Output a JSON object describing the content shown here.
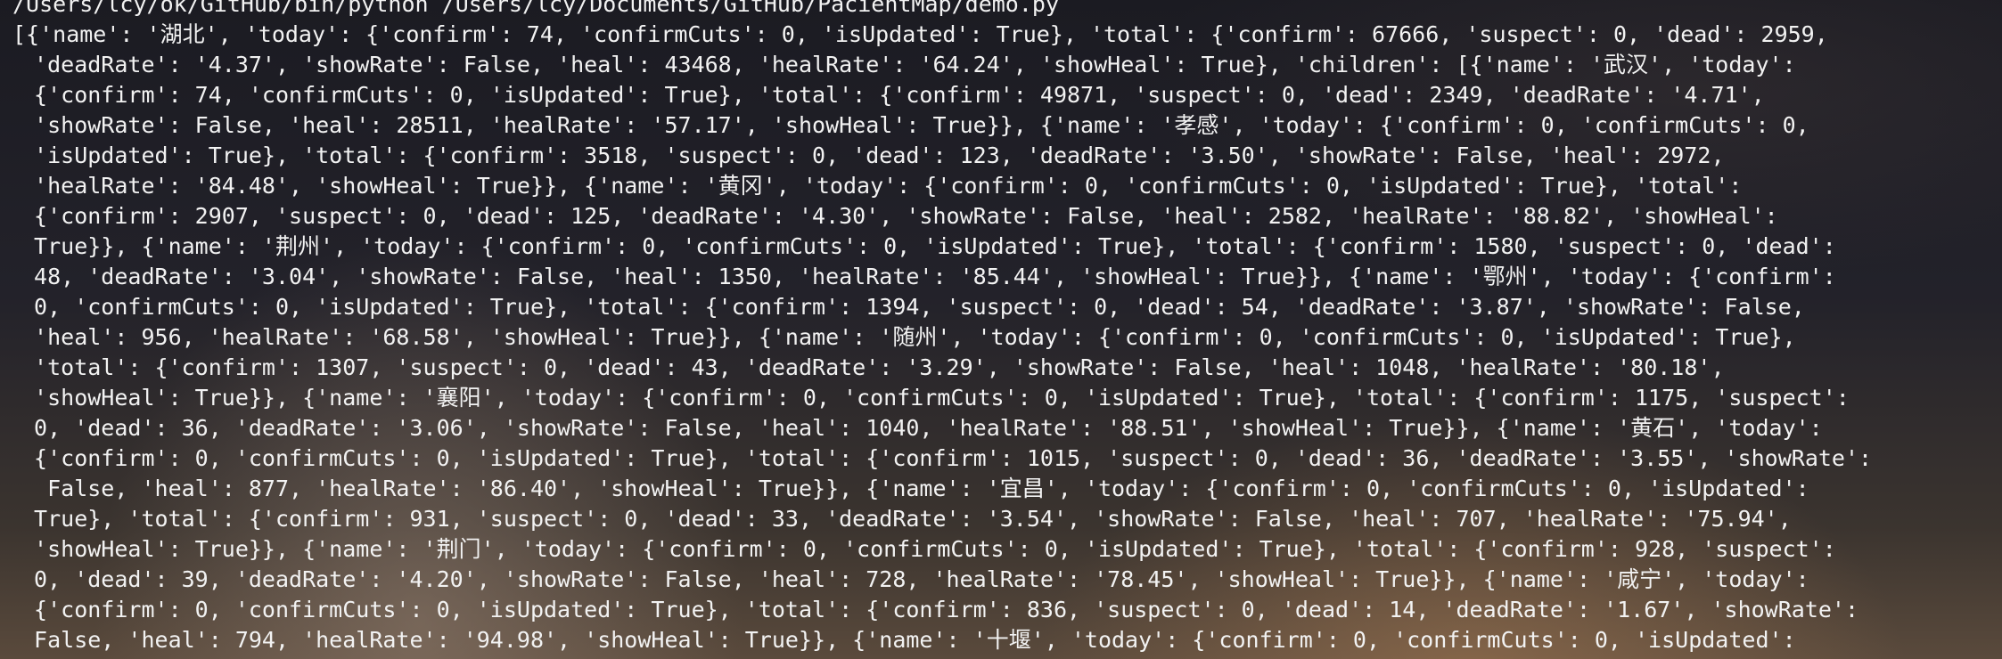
{
  "terminal": {
    "command_line": "/Users/lcy/ok/GitHub/bin/python /Users/lcy/Documents/GitHub/PacientMap/demo.py",
    "output_lines": [
      "[{'name': '湖北', 'today': {'confirm': 74, 'confirmCuts': 0, 'isUpdated': True}, 'total': {'confirm': 67666, 'suspect': 0, 'dead': 2959,",
      " 'deadRate': '4.37', 'showRate': False, 'heal': 43468, 'healRate': '64.24', 'showHeal': True}, 'children': [{'name': '武汉', 'today':",
      " {'confirm': 74, 'confirmCuts': 0, 'isUpdated': True}, 'total': {'confirm': 49871, 'suspect': 0, 'dead': 2349, 'deadRate': '4.71',",
      " 'showRate': False, 'heal': 28511, 'healRate': '57.17', 'showHeal': True}}, {'name': '孝感', 'today': {'confirm': 0, 'confirmCuts': 0,",
      " 'isUpdated': True}, 'total': {'confirm': 3518, 'suspect': 0, 'dead': 123, 'deadRate': '3.50', 'showRate': False, 'heal': 2972,",
      " 'healRate': '84.48', 'showHeal': True}}, {'name': '黄冈', 'today': {'confirm': 0, 'confirmCuts': 0, 'isUpdated': True}, 'total':",
      " {'confirm': 2907, 'suspect': 0, 'dead': 125, 'deadRate': '4.30', 'showRate': False, 'heal': 2582, 'healRate': '88.82', 'showHeal':",
      " True}}, {'name': '荆州', 'today': {'confirm': 0, 'confirmCuts': 0, 'isUpdated': True}, 'total': {'confirm': 1580, 'suspect': 0, 'dead':",
      " 48, 'deadRate': '3.04', 'showRate': False, 'heal': 1350, 'healRate': '85.44', 'showHeal': True}}, {'name': '鄂州', 'today': {'confirm':",
      " 0, 'confirmCuts': 0, 'isUpdated': True}, 'total': {'confirm': 1394, 'suspect': 0, 'dead': 54, 'deadRate': '3.87', 'showRate': False,",
      " 'heal': 956, 'healRate': '68.58', 'showHeal': True}}, {'name': '随州', 'today': {'confirm': 0, 'confirmCuts': 0, 'isUpdated': True},",
      " 'total': {'confirm': 1307, 'suspect': 0, 'dead': 43, 'deadRate': '3.29', 'showRate': False, 'heal': 1048, 'healRate': '80.18',",
      " 'showHeal': True}}, {'name': '襄阳', 'today': {'confirm': 0, 'confirmCuts': 0, 'isUpdated': True}, 'total': {'confirm': 1175, 'suspect':",
      " 0, 'dead': 36, 'deadRate': '3.06', 'showRate': False, 'heal': 1040, 'healRate': '88.51', 'showHeal': True}}, {'name': '黄石', 'today':",
      " {'confirm': 0, 'confirmCuts': 0, 'isUpdated': True}, 'total': {'confirm': 1015, 'suspect': 0, 'dead': 36, 'deadRate': '3.55', 'showRate':",
      "  False, 'heal': 877, 'healRate': '86.40', 'showHeal': True}}, {'name': '宜昌', 'today': {'confirm': 0, 'confirmCuts': 0, 'isUpdated':",
      " True}, 'total': {'confirm': 931, 'suspect': 0, 'dead': 33, 'deadRate': '3.54', 'showRate': False, 'heal': 707, 'healRate': '75.94',",
      " 'showHeal': True}}, {'name': '荆门', 'today': {'confirm': 0, 'confirmCuts': 0, 'isUpdated': True}, 'total': {'confirm': 928, 'suspect':",
      " 0, 'dead': 39, 'deadRate': '4.20', 'showRate': False, 'heal': 728, 'healRate': '78.45', 'showHeal': True}}, {'name': '咸宁', 'today':",
      " {'confirm': 0, 'confirmCuts': 0, 'isUpdated': True}, 'total': {'confirm': 836, 'suspect': 0, 'dead': 14, 'deadRate': '1.67', 'showRate':",
      " False, 'heal': 794, 'healRate': '94.98', 'showHeal': True}}, {'name': '十堰', 'today': {'confirm': 0, 'confirmCuts': 0, 'isUpdated':"
    ]
  }
}
